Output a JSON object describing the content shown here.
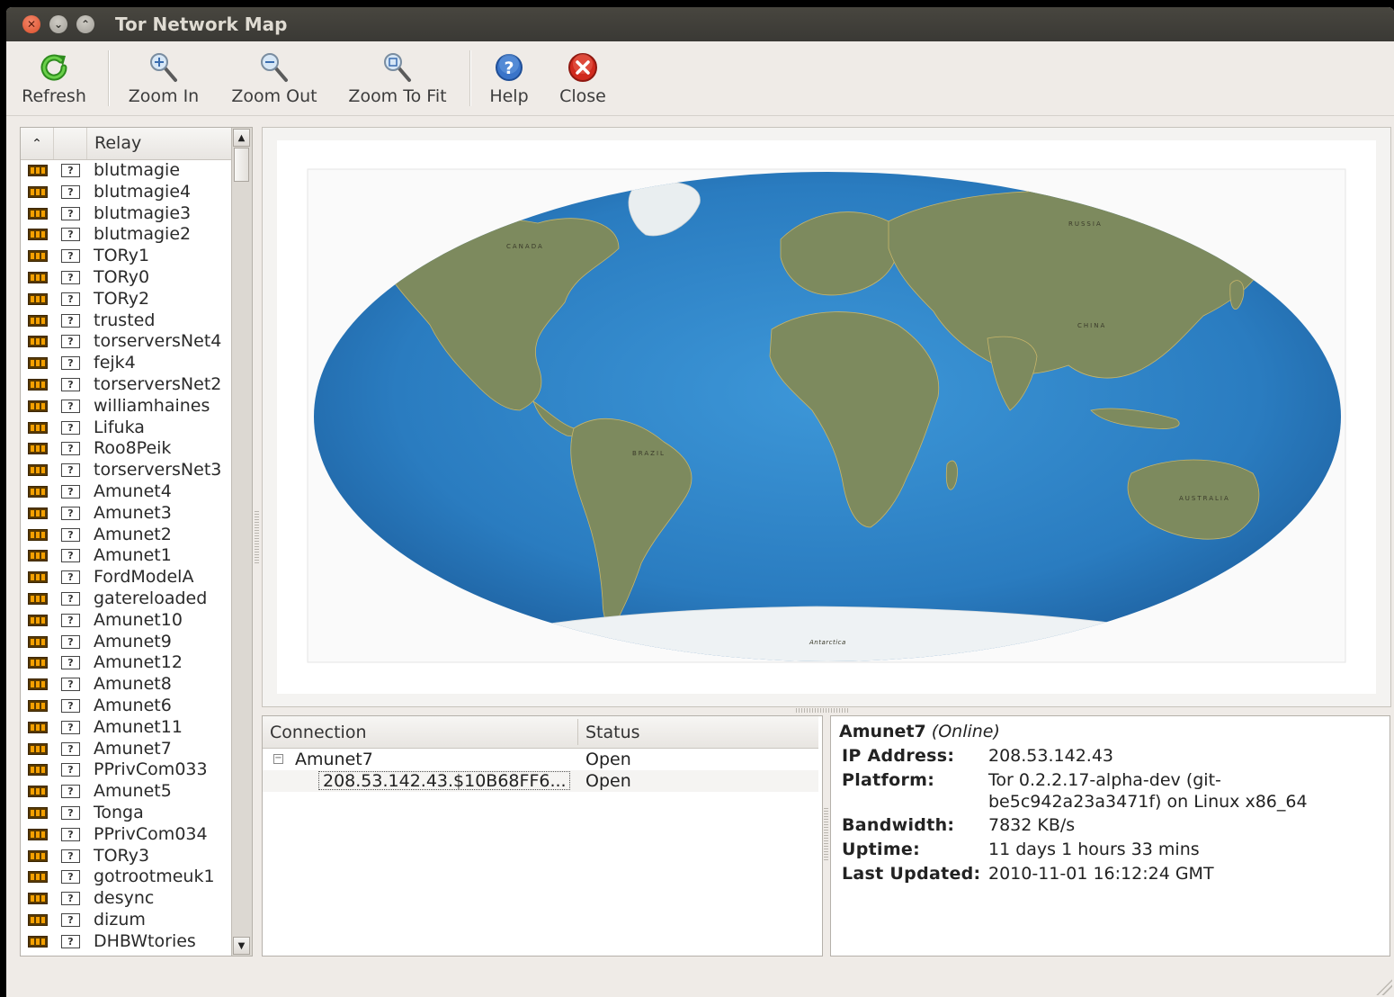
{
  "window": {
    "title": "Tor Network Map"
  },
  "toolbar": {
    "refresh": "Refresh",
    "zoom_in": "Zoom In",
    "zoom_out": "Zoom Out",
    "zoom_to_fit": "Zoom To Fit",
    "help": "Help",
    "close": "Close"
  },
  "relay_list": {
    "header": "Relay",
    "flag_glyph": "?",
    "items": [
      "blutmagie",
      "blutmagie4",
      "blutmagie3",
      "blutmagie2",
      "TORy1",
      "TORy0",
      "TORy2",
      "trusted",
      "torserversNet4",
      "fejk4",
      "torserversNet2",
      "williamhaines",
      "Lifuka",
      "Roo8Peik",
      "torserversNet3",
      "Amunet4",
      "Amunet3",
      "Amunet2",
      "Amunet1",
      "FordModelA",
      "gatereloaded",
      "Amunet10",
      "Amunet9",
      "Amunet12",
      "Amunet8",
      "Amunet6",
      "Amunet11",
      "Amunet7",
      "PPrivCom033",
      "Amunet5",
      "Tonga",
      "PPrivCom034",
      "TORy3",
      "gotrootmeuk1",
      "desync",
      "dizum",
      "DHBWtories"
    ]
  },
  "map": {
    "labels": {
      "canada": "CANADA",
      "russia": "RUSSIA",
      "china": "CHINA",
      "brazil": "BRAZIL",
      "australia": "AUSTRALIA",
      "antarctica": "Antarctica"
    }
  },
  "connections": {
    "col_connection": "Connection",
    "col_status": "Status",
    "rows": [
      {
        "name": "Amunet7",
        "status": "Open",
        "expander": "−"
      },
      {
        "name": "208.53.142.43.$10B68FF6...",
        "status": "Open"
      }
    ]
  },
  "info": {
    "name": "Amunet7",
    "state": "(Online)",
    "ip_label": "IP Address:",
    "ip_value": "208.53.142.43",
    "platform_label": "Platform:",
    "platform_value": "Tor 0.2.2.17-alpha-dev (git-be5c942a23a3471f) on Linux x86_64",
    "bandwidth_label": "Bandwidth:",
    "bandwidth_value": "7832 KB/s",
    "uptime_label": "Uptime:",
    "uptime_value": "11 days 1 hours 33 mins",
    "updated_label": "Last Updated:",
    "updated_value": "2010-11-01 16:12:24 GMT"
  },
  "colors": {
    "ocean": "#2f7fc0",
    "land": "#7d8a5e",
    "ice": "#eef2f4",
    "bandwidth_bar": "#f5a000"
  }
}
